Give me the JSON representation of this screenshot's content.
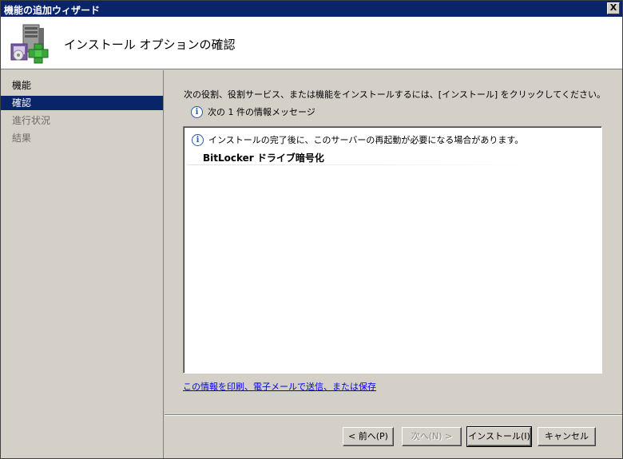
{
  "window": {
    "title": "機能の追加ウィザード",
    "close_glyph": "X"
  },
  "header": {
    "title": "インストール オプションの確認",
    "icon": "server-add-icon"
  },
  "sidebar": {
    "items": [
      {
        "label": "機能",
        "state": "normal"
      },
      {
        "label": "確認",
        "state": "current"
      },
      {
        "label": "進行状況",
        "state": "disabled"
      },
      {
        "label": "結果",
        "state": "disabled"
      }
    ]
  },
  "main": {
    "instruction": "次の役割、役割サービス、または機能をインストールするには、[インストール] をクリックしてください。",
    "message_count": "次の 1 件の情報メッセージ",
    "panel": {
      "message": "インストールの完了後に、このサーバーの再起動が必要になる場合があります。",
      "feature": "BitLocker ドライブ暗号化"
    },
    "link": "この情報を印刷、電子メールで送信、または保存"
  },
  "footer": {
    "back_label": "< 前へ(P)",
    "next_label": "次へ(N) >",
    "install_label": "インストール(I)",
    "cancel_label": "キャンセル"
  },
  "colors": {
    "titlebar": "#0a246a",
    "selected": "#0a246a",
    "link": "#0000ee",
    "info": "#2a5aa8"
  }
}
